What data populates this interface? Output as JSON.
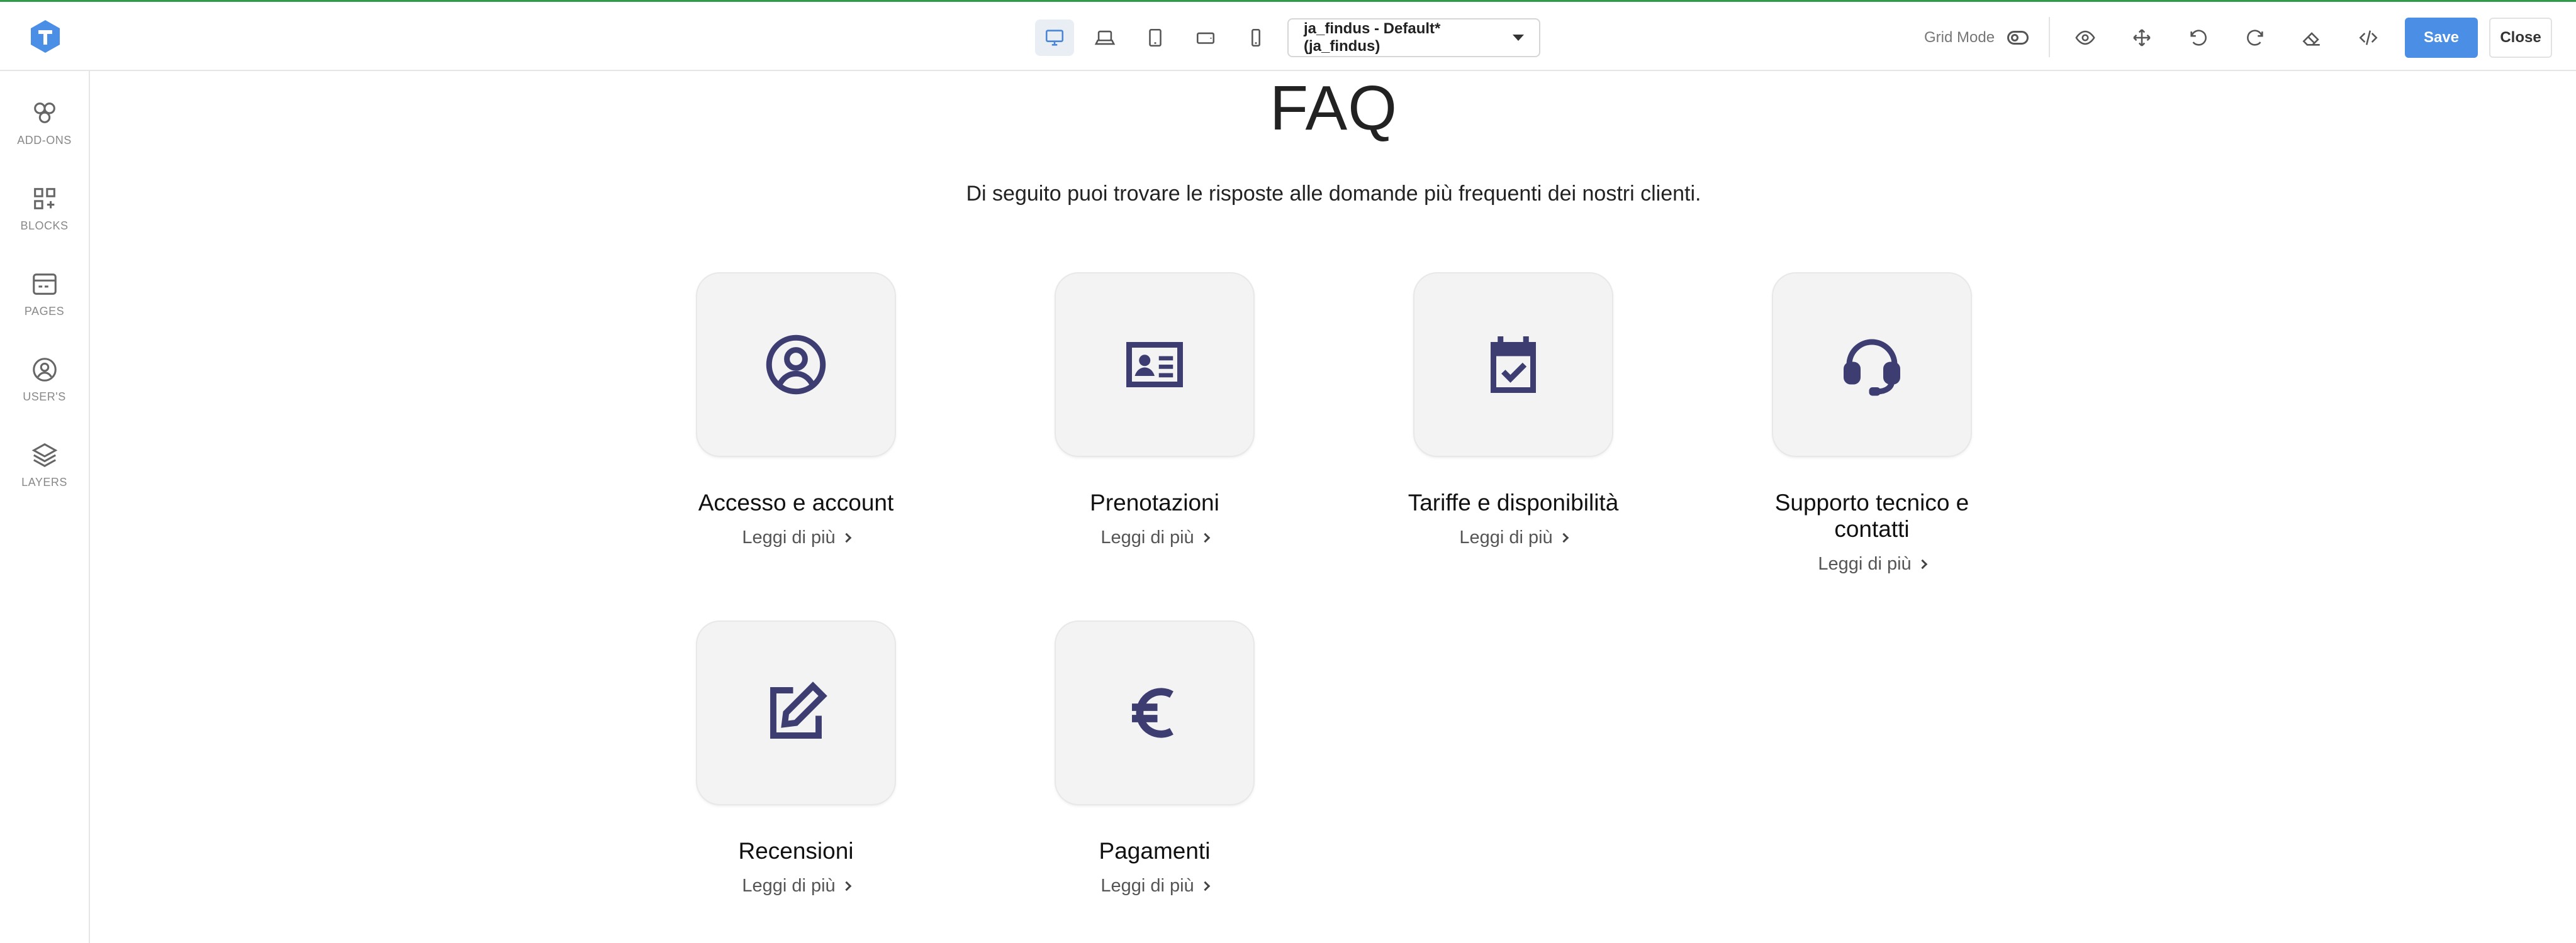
{
  "toolbar": {
    "template_select": "ja_findus - Default* (ja_findus)",
    "grid_mode_label": "Grid Mode",
    "save_label": "Save",
    "close_label": "Close",
    "accent_color": "#4a8ee6"
  },
  "sidebar": {
    "items": [
      {
        "label": "ADD-ONS",
        "icon": "addons-icon"
      },
      {
        "label": "BLOCKS",
        "icon": "blocks-icon"
      },
      {
        "label": "PAGES",
        "icon": "pages-icon"
      },
      {
        "label": "USER'S",
        "icon": "user-icon"
      },
      {
        "label": "LAYERS",
        "icon": "layers-icon"
      }
    ]
  },
  "main": {
    "title": "FAQ",
    "subtitle": "Di seguito puoi trovare le risposte alle domande più frequenti dei nostri clienti.",
    "cards": [
      {
        "title": "Accesso e account",
        "link": "Leggi di più",
        "icon": "user-circle-icon"
      },
      {
        "title": "Prenotazioni",
        "link": "Leggi di più",
        "icon": "id-card-icon"
      },
      {
        "title": "Tariffe e disponibilità",
        "link": "Leggi di più",
        "icon": "calendar-check-icon"
      },
      {
        "title": "Supporto tecnico e contatti",
        "link": "Leggi di più",
        "icon": "headset-icon"
      },
      {
        "title": "Recensioni",
        "link": "Leggi di più",
        "icon": "edit-icon"
      },
      {
        "title": "Pagamenti",
        "link": "Leggi di più",
        "icon": "euro-icon"
      }
    ]
  }
}
